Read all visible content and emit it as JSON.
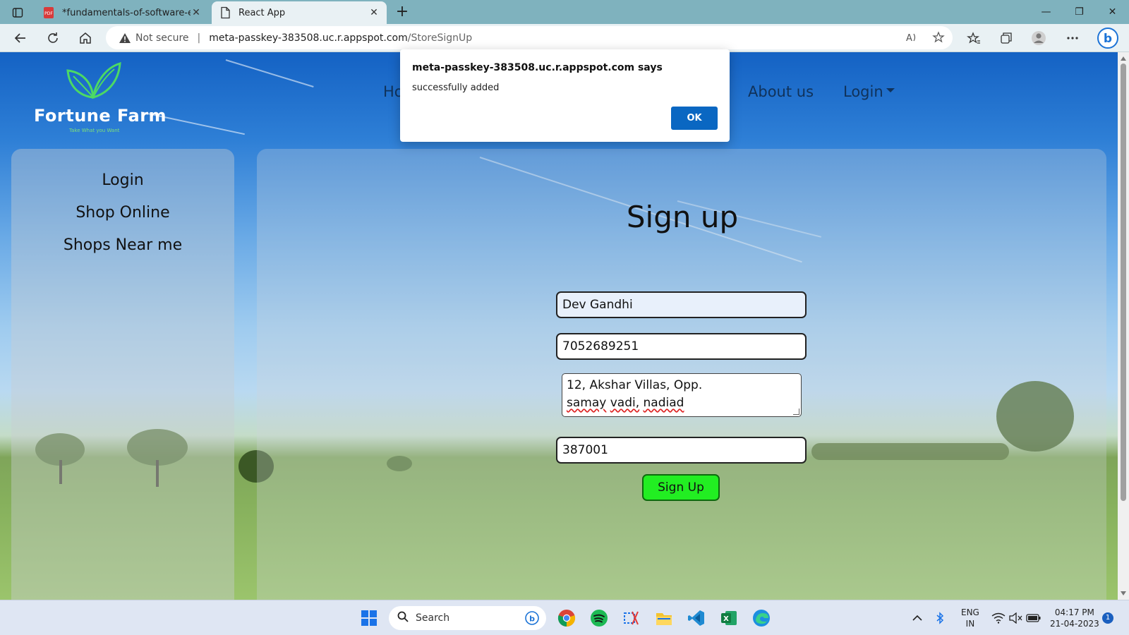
{
  "browser": {
    "tabs": [
      {
        "title": "*fundamentals-of-software-engi",
        "active": false,
        "icon": "pdf-icon"
      },
      {
        "title": "React App",
        "active": true,
        "icon": "page-icon"
      }
    ],
    "address": {
      "security_label": "Not secure",
      "host": "meta-passkey-383508.uc.r.appspot.com",
      "path": "/StoreSignUp"
    }
  },
  "site": {
    "brand": "Fortune Farm",
    "tagline": "Take What you Want",
    "nav": {
      "home_partial": "Ho",
      "about": "About us",
      "login": "Login"
    },
    "sidebar": {
      "items": [
        {
          "label": "Login"
        },
        {
          "label": "Shop Online"
        },
        {
          "label": "Shops Near me"
        }
      ]
    },
    "form": {
      "title": "Sign up",
      "name_value": "Dev Gandhi",
      "phone_value": "7052689251",
      "address_line1": "12, Akshar Villas, Opp.",
      "address_line2_words": [
        "samay",
        "vadi,",
        "nadiad"
      ],
      "pincode_value": "387001",
      "submit_label": "Sign Up"
    }
  },
  "dialog": {
    "title": "meta-passkey-383508.uc.r.appspot.com says",
    "message": "successfully added",
    "ok_label": "OK"
  },
  "taskbar": {
    "search_label": "Search",
    "lang_line1": "ENG",
    "lang_line2": "IN",
    "time": "04:17 PM",
    "date": "21-04-2023",
    "notification_count": "1"
  },
  "colors": {
    "signup_button": "#22ee22",
    "ok_button": "#0a67c2",
    "nav_text": "#10325a"
  }
}
